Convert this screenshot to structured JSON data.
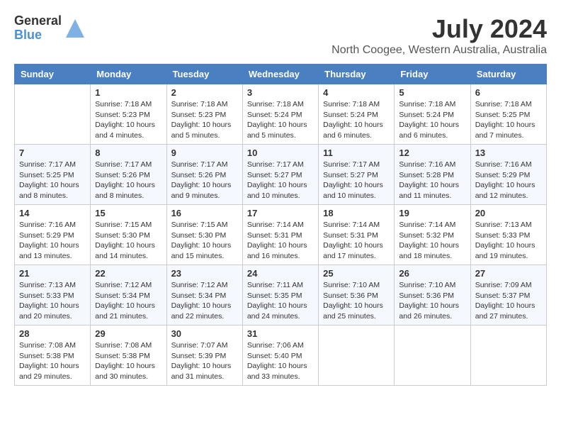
{
  "header": {
    "logo_general": "General",
    "logo_blue": "Blue",
    "month_title": "July 2024",
    "location": "North Coogee, Western Australia, Australia"
  },
  "weekdays": [
    "Sunday",
    "Monday",
    "Tuesday",
    "Wednesday",
    "Thursday",
    "Friday",
    "Saturday"
  ],
  "weeks": [
    [
      {
        "day": "",
        "info": ""
      },
      {
        "day": "1",
        "info": "Sunrise: 7:18 AM\nSunset: 5:23 PM\nDaylight: 10 hours\nand 4 minutes."
      },
      {
        "day": "2",
        "info": "Sunrise: 7:18 AM\nSunset: 5:23 PM\nDaylight: 10 hours\nand 5 minutes."
      },
      {
        "day": "3",
        "info": "Sunrise: 7:18 AM\nSunset: 5:24 PM\nDaylight: 10 hours\nand 5 minutes."
      },
      {
        "day": "4",
        "info": "Sunrise: 7:18 AM\nSunset: 5:24 PM\nDaylight: 10 hours\nand 6 minutes."
      },
      {
        "day": "5",
        "info": "Sunrise: 7:18 AM\nSunset: 5:24 PM\nDaylight: 10 hours\nand 6 minutes."
      },
      {
        "day": "6",
        "info": "Sunrise: 7:18 AM\nSunset: 5:25 PM\nDaylight: 10 hours\nand 7 minutes."
      }
    ],
    [
      {
        "day": "7",
        "info": "Sunrise: 7:17 AM\nSunset: 5:25 PM\nDaylight: 10 hours\nand 8 minutes."
      },
      {
        "day": "8",
        "info": "Sunrise: 7:17 AM\nSunset: 5:26 PM\nDaylight: 10 hours\nand 8 minutes."
      },
      {
        "day": "9",
        "info": "Sunrise: 7:17 AM\nSunset: 5:26 PM\nDaylight: 10 hours\nand 9 minutes."
      },
      {
        "day": "10",
        "info": "Sunrise: 7:17 AM\nSunset: 5:27 PM\nDaylight: 10 hours\nand 10 minutes."
      },
      {
        "day": "11",
        "info": "Sunrise: 7:17 AM\nSunset: 5:27 PM\nDaylight: 10 hours\nand 10 minutes."
      },
      {
        "day": "12",
        "info": "Sunrise: 7:16 AM\nSunset: 5:28 PM\nDaylight: 10 hours\nand 11 minutes."
      },
      {
        "day": "13",
        "info": "Sunrise: 7:16 AM\nSunset: 5:29 PM\nDaylight: 10 hours\nand 12 minutes."
      }
    ],
    [
      {
        "day": "14",
        "info": "Sunrise: 7:16 AM\nSunset: 5:29 PM\nDaylight: 10 hours\nand 13 minutes."
      },
      {
        "day": "15",
        "info": "Sunrise: 7:15 AM\nSunset: 5:30 PM\nDaylight: 10 hours\nand 14 minutes."
      },
      {
        "day": "16",
        "info": "Sunrise: 7:15 AM\nSunset: 5:30 PM\nDaylight: 10 hours\nand 15 minutes."
      },
      {
        "day": "17",
        "info": "Sunrise: 7:14 AM\nSunset: 5:31 PM\nDaylight: 10 hours\nand 16 minutes."
      },
      {
        "day": "18",
        "info": "Sunrise: 7:14 AM\nSunset: 5:31 PM\nDaylight: 10 hours\nand 17 minutes."
      },
      {
        "day": "19",
        "info": "Sunrise: 7:14 AM\nSunset: 5:32 PM\nDaylight: 10 hours\nand 18 minutes."
      },
      {
        "day": "20",
        "info": "Sunrise: 7:13 AM\nSunset: 5:33 PM\nDaylight: 10 hours\nand 19 minutes."
      }
    ],
    [
      {
        "day": "21",
        "info": "Sunrise: 7:13 AM\nSunset: 5:33 PM\nDaylight: 10 hours\nand 20 minutes."
      },
      {
        "day": "22",
        "info": "Sunrise: 7:12 AM\nSunset: 5:34 PM\nDaylight: 10 hours\nand 21 minutes."
      },
      {
        "day": "23",
        "info": "Sunrise: 7:12 AM\nSunset: 5:34 PM\nDaylight: 10 hours\nand 22 minutes."
      },
      {
        "day": "24",
        "info": "Sunrise: 7:11 AM\nSunset: 5:35 PM\nDaylight: 10 hours\nand 24 minutes."
      },
      {
        "day": "25",
        "info": "Sunrise: 7:10 AM\nSunset: 5:36 PM\nDaylight: 10 hours\nand 25 minutes."
      },
      {
        "day": "26",
        "info": "Sunrise: 7:10 AM\nSunset: 5:36 PM\nDaylight: 10 hours\nand 26 minutes."
      },
      {
        "day": "27",
        "info": "Sunrise: 7:09 AM\nSunset: 5:37 PM\nDaylight: 10 hours\nand 27 minutes."
      }
    ],
    [
      {
        "day": "28",
        "info": "Sunrise: 7:08 AM\nSunset: 5:38 PM\nDaylight: 10 hours\nand 29 minutes."
      },
      {
        "day": "29",
        "info": "Sunrise: 7:08 AM\nSunset: 5:38 PM\nDaylight: 10 hours\nand 30 minutes."
      },
      {
        "day": "30",
        "info": "Sunrise: 7:07 AM\nSunset: 5:39 PM\nDaylight: 10 hours\nand 31 minutes."
      },
      {
        "day": "31",
        "info": "Sunrise: 7:06 AM\nSunset: 5:40 PM\nDaylight: 10 hours\nand 33 minutes."
      },
      {
        "day": "",
        "info": ""
      },
      {
        "day": "",
        "info": ""
      },
      {
        "day": "",
        "info": ""
      }
    ]
  ]
}
